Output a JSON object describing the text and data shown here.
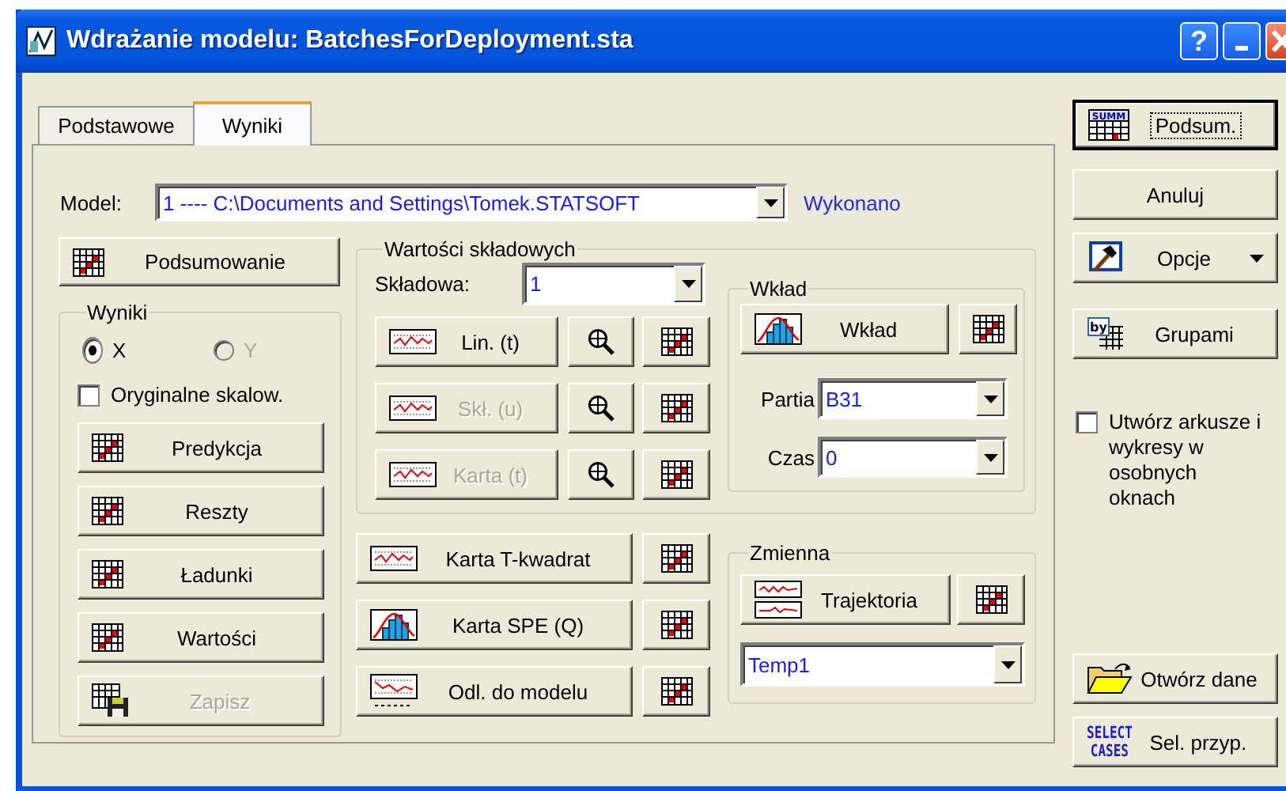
{
  "window": {
    "title": "Wdrażanie modelu: BatchesForDeployment.sta",
    "help": "?"
  },
  "tabs": [
    {
      "label": "Podstawowe",
      "selected": false
    },
    {
      "label": "Wyniki",
      "selected": true
    }
  ],
  "model": {
    "label": "Model:",
    "value": "1 ---- C:\\Documents and Settings\\Tomek.STATSOFT",
    "status": "Wykonano"
  },
  "summary_button": {
    "label": "Podsumowanie",
    "kind": "table"
  },
  "results": {
    "title": "Wyniki",
    "radios": [
      {
        "label": "X",
        "selected": true,
        "disabled": false
      },
      {
        "label": "Y",
        "selected": false,
        "disabled": true
      }
    ],
    "checkbox": {
      "label": "Oryginalne skalow.",
      "checked": false
    },
    "buttons": [
      {
        "label": "Predykcja",
        "kind": "table",
        "disabled": false
      },
      {
        "label": "Reszty",
        "kind": "table",
        "disabled": false
      },
      {
        "label": "Ładunki",
        "kind": "table",
        "disabled": false
      },
      {
        "label": "Wartości",
        "kind": "table",
        "disabled": false
      },
      {
        "label": "Zapisz",
        "kind": "save",
        "disabled": true
      }
    ]
  },
  "components": {
    "title": "Wartości składowych",
    "field": {
      "label": "Składowa:",
      "value": "1"
    },
    "rows": [
      {
        "label": "Lin. (t)",
        "disabled": false
      },
      {
        "label": "Skł. (u)",
        "disabled": true
      },
      {
        "label": "Karta (t)",
        "disabled": true
      }
    ]
  },
  "contribution": {
    "title": "Wkład",
    "button": "Wkład",
    "fields": [
      {
        "label": "Partia",
        "value": "B31"
      },
      {
        "label": "Czas",
        "value": "0"
      }
    ]
  },
  "chart_buttons": [
    {
      "label": "Karta T-kwadrat",
      "kind": "line"
    },
    {
      "label": "Karta SPE (Q)",
      "kind": "histogram"
    },
    {
      "label": "Odl. do modelu",
      "kind": "distance"
    }
  ],
  "variable": {
    "title": "Zmienna",
    "button": "Trajektoria",
    "value": "Temp1"
  },
  "side_buttons": [
    {
      "label": "Podsum.",
      "kind": "summ",
      "icon_text": [
        "SUMM"
      ],
      "focused": true,
      "menu": false
    },
    {
      "label": "Anuluj",
      "focused": false,
      "menu": false
    },
    {
      "label": "Opcje",
      "kind": "hammer",
      "focused": false,
      "menu": true
    },
    {
      "label": "Grupami",
      "kind": "by",
      "icon_text": [
        "by"
      ],
      "focused": false,
      "menu": false
    }
  ],
  "side_checkbox": {
    "label": "Utwórz arkusze i wykresy w osobnych oknach",
    "checked": false
  },
  "bottom_buttons": [
    {
      "label": "Otwórz dane",
      "kind": "folder"
    },
    {
      "label": "Sel. przyp.",
      "kind": "select",
      "icon_text": [
        "SELECT",
        "CASES"
      ]
    }
  ]
}
